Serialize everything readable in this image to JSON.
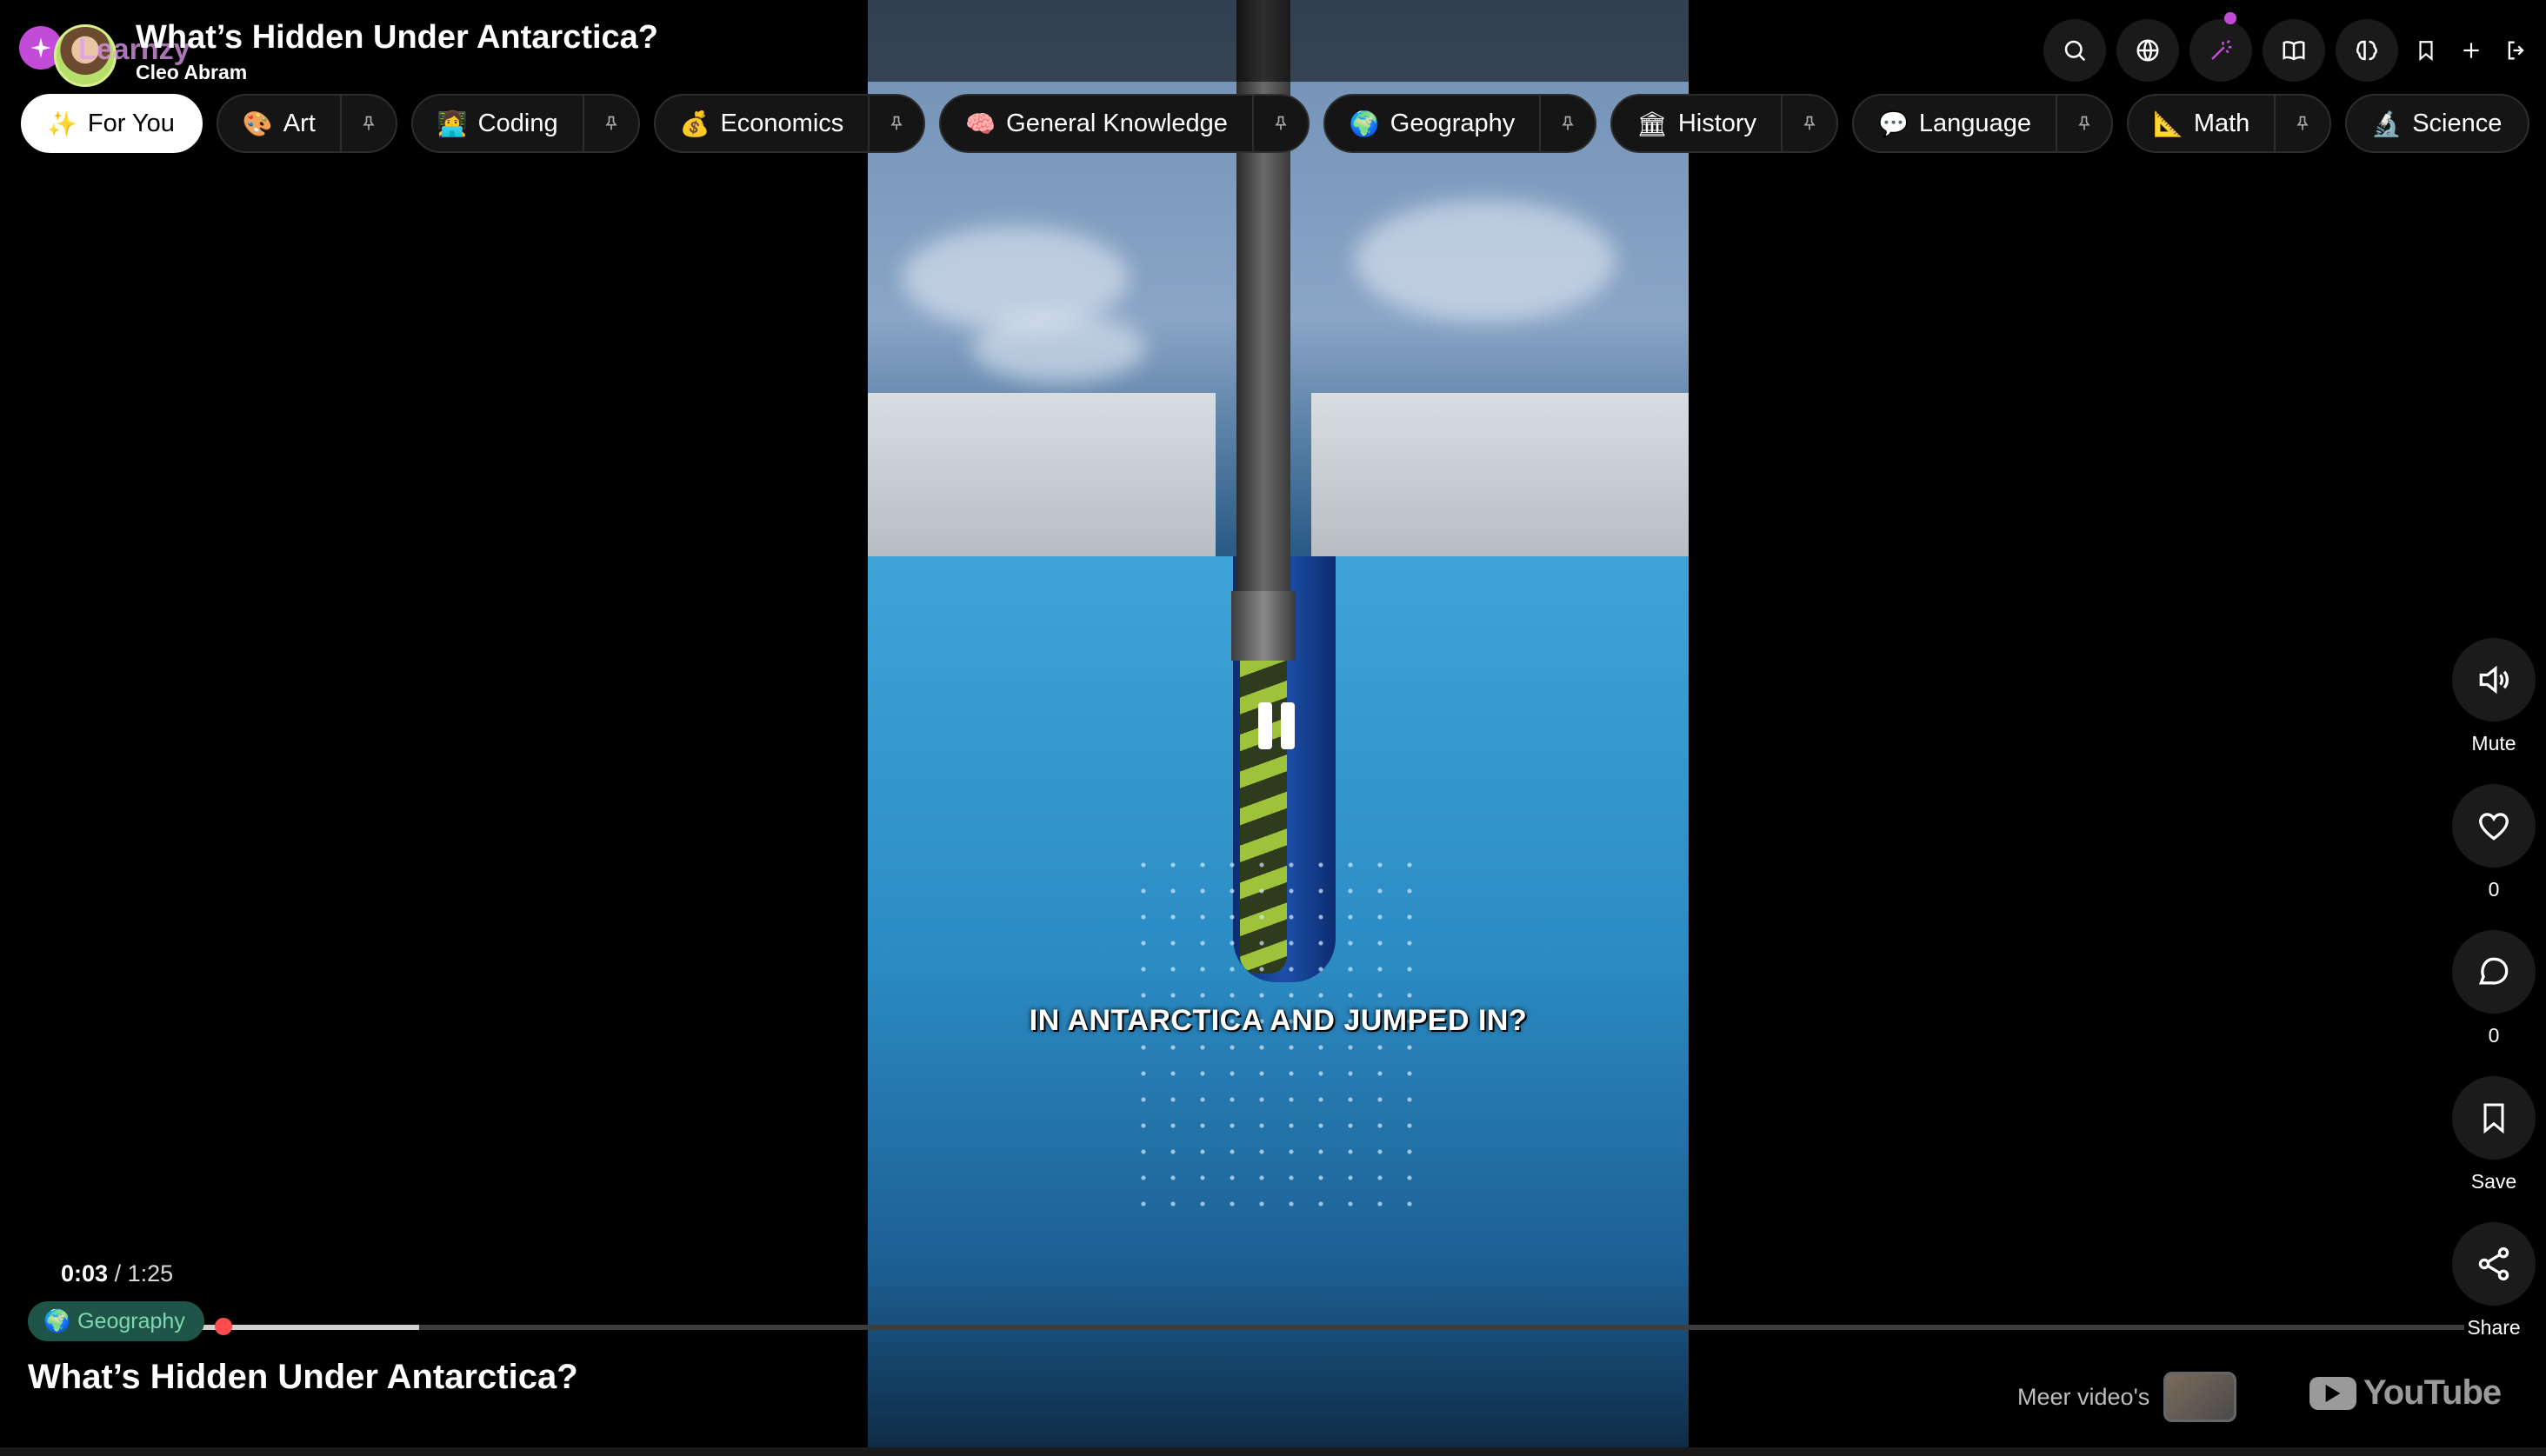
{
  "header": {
    "brand": "Learnzy",
    "title": "What’s Hidden Under Antarctica?",
    "channel": "Cleo Abram"
  },
  "top_icons": [
    "search-icon",
    "globe-icon",
    "magic-wand-icon",
    "book-icon",
    "brain-icon",
    "bookmark-icon",
    "plus-icon",
    "logout-icon"
  ],
  "categories": [
    {
      "emoji": "✨",
      "label": "For You",
      "active": true
    },
    {
      "emoji": "🎨",
      "label": "Art"
    },
    {
      "emoji": "👩‍💻",
      "label": "Coding"
    },
    {
      "emoji": "💰",
      "label": "Economics"
    },
    {
      "emoji": "🧠",
      "label": "General Knowledge"
    },
    {
      "emoji": "🌍",
      "label": "Geography"
    },
    {
      "emoji": "🏛",
      "label": "History"
    },
    {
      "emoji": "💬",
      "label": "Language"
    },
    {
      "emoji": "📐",
      "label": "Math"
    },
    {
      "emoji": "🔬",
      "label": "Science"
    }
  ],
  "video": {
    "caption": "IN ANTARCTICA AND JUMPED IN?",
    "state": "playing",
    "current_time": "0:03",
    "separator": "/",
    "duration": "1:25",
    "progress_fraction": 0.035,
    "buffered_fraction": 0.16
  },
  "actions": {
    "mute": "Mute",
    "likes": "0",
    "comments": "0",
    "save": "Save",
    "share": "Share"
  },
  "footer": {
    "tag_emoji": "🌍",
    "tag_label": "Geography",
    "title": "What’s Hidden Under Antarctica?",
    "more_videos": "Meer video's",
    "youtube": "YouTube"
  },
  "colors": {
    "accent": "#c24bd8",
    "tag_bg": "#1f5548",
    "tag_text": "#7fd7b0"
  }
}
